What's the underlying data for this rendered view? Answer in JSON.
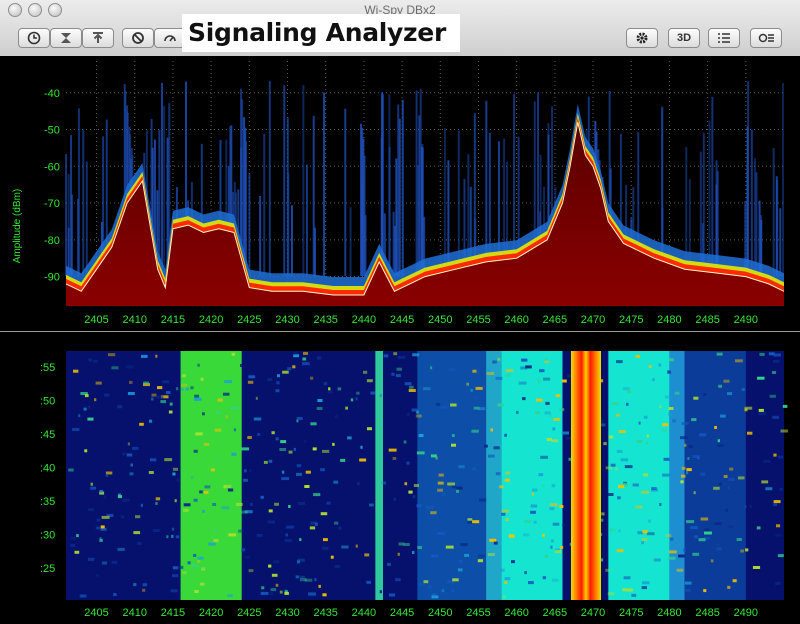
{
  "window": {
    "title": "Wi-Spy DBx2"
  },
  "overlay": {
    "brand_label": "Signaling Analyzer"
  },
  "toolbar": {
    "buttons": [
      {
        "name": "clock-icon"
      },
      {
        "name": "clear-icon"
      },
      {
        "name": "upload-icon"
      },
      {
        "name": "stop-icon"
      },
      {
        "name": "gauge-icon"
      }
    ],
    "right": {
      "settings_icon": "gear-icon",
      "three_d_label": "3D",
      "list_icon": "list-icon",
      "adjust_icon": "adjust-icon"
    }
  },
  "colors": {
    "tick": "#35e635",
    "grid": "#5a5a5a",
    "background": "#000000"
  },
  "chart_data": [
    {
      "type": "area",
      "ylabel": "Amplitude (dBm)",
      "x_ticks": [
        "2405",
        "2410",
        "2415",
        "2420",
        "2425",
        "2430",
        "2435",
        "2440",
        "2445",
        "2450",
        "2455",
        "2460",
        "2465",
        "2470",
        "2475",
        "2480",
        "2485",
        "2490"
      ],
      "y_ticks": [
        "-40",
        "-50",
        "-60",
        "-70",
        "-80",
        "-90"
      ],
      "xlim": [
        2401,
        2495
      ],
      "ylim": [
        -98,
        -30
      ],
      "grid": true,
      "series": [
        {
          "values_x": [
            2401,
            2403,
            2405,
            2407,
            2409,
            2411,
            2413,
            2414,
            2415,
            2417,
            2419,
            2421,
            2423,
            2425,
            2428,
            2432,
            2436,
            2440,
            2442,
            2444,
            2448,
            2452,
            2456,
            2460,
            2464,
            2466,
            2467,
            2468,
            2469,
            2470,
            2471,
            2472,
            2474,
            2478,
            2482,
            2486,
            2490,
            2493,
            2495
          ],
          "values_y": [
            -92,
            -94,
            -88,
            -82,
            -70,
            -64,
            -88,
            -93,
            -77,
            -76,
            -78,
            -77,
            -78,
            -93,
            -94,
            -94,
            -95,
            -95,
            -86,
            -94,
            -90,
            -88,
            -86,
            -85,
            -80,
            -70,
            -60,
            -48,
            -57,
            -60,
            -66,
            -75,
            -81,
            -85,
            -88,
            -89,
            -90,
            -92,
            -94
          ]
        }
      ]
    },
    {
      "type": "heatmap",
      "x_ticks": [
        "2405",
        "2410",
        "2415",
        "2420",
        "2425",
        "2430",
        "2435",
        "2440",
        "2445",
        "2450",
        "2455",
        "2460",
        "2465",
        "2470",
        "2475",
        "2480",
        "2485",
        "2490"
      ],
      "y_ticks": [
        ":55",
        ":50",
        ":45",
        ":40",
        ":35",
        ":30",
        ":25"
      ]
    }
  ]
}
